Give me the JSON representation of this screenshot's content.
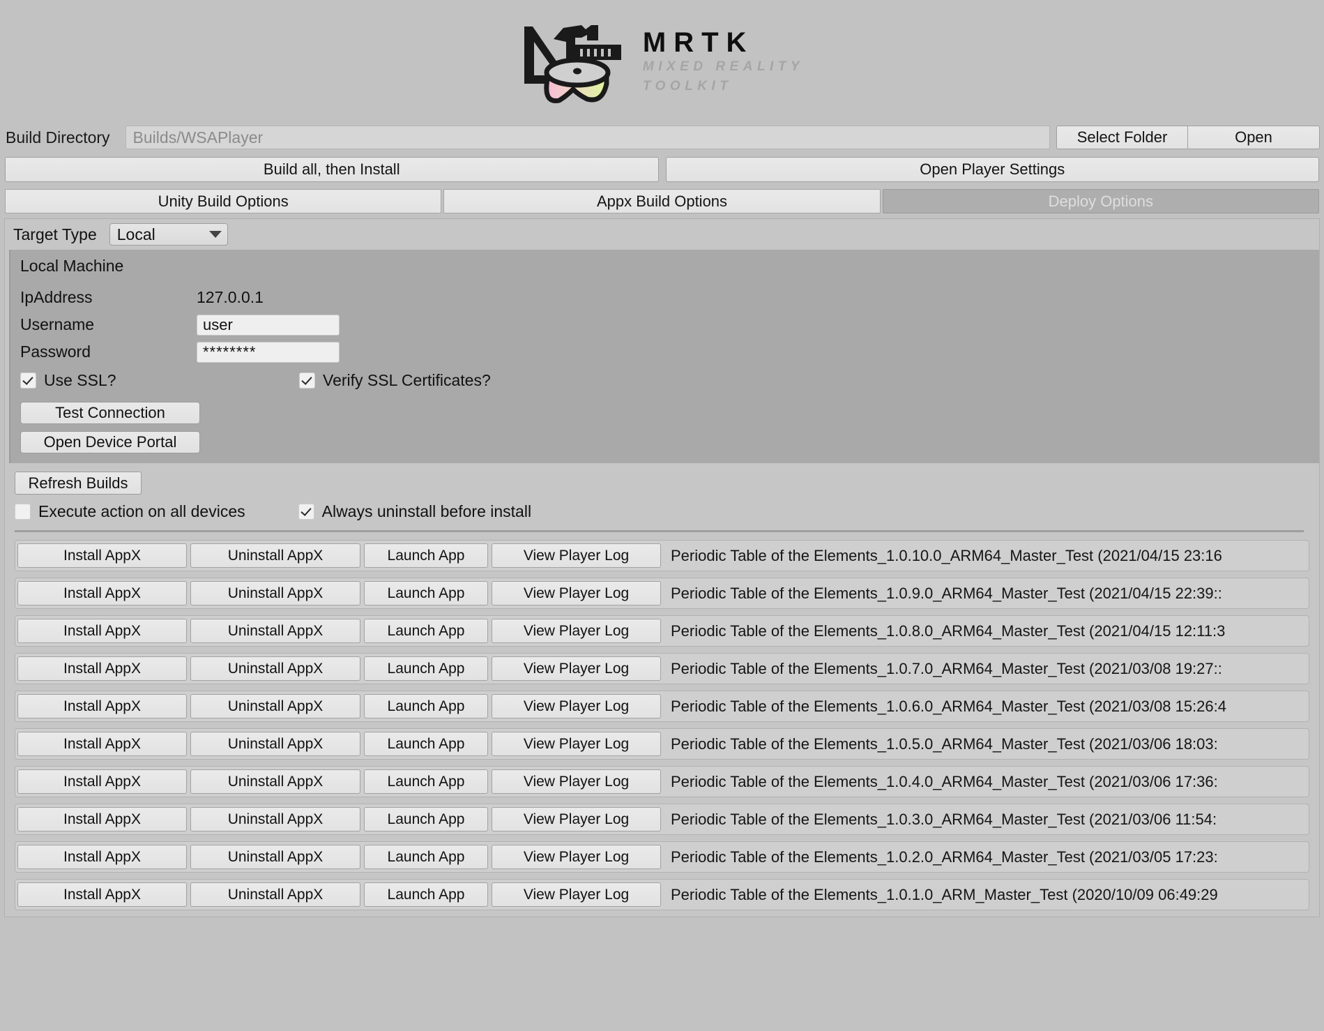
{
  "branding": {
    "title": "MRTK",
    "subtitle_line1": "MIXED REALITY",
    "subtitle_line2": "TOOLKIT",
    "logo_icon": "mrtk-hammer-ruler-visor-logo",
    "visor_gradient_start": "#f7c0d8",
    "visor_gradient_end": "#dff5a0"
  },
  "build_directory": {
    "label": "Build Directory",
    "value": "Builds/WSAPlayer",
    "select_folder_label": "Select Folder",
    "open_label": "Open"
  },
  "actions": {
    "build_all_label": "Build all, then Install",
    "player_settings_label": "Open Player Settings"
  },
  "tabs": [
    {
      "label": "Unity Build Options",
      "active": false
    },
    {
      "label": "Appx Build Options",
      "active": false
    },
    {
      "label": "Deploy Options",
      "active": true
    }
  ],
  "target": {
    "label": "Target Type",
    "selected": "Local",
    "caret_icon": "chevron-down-icon"
  },
  "device": {
    "title": "Local Machine",
    "ip_label": "IpAddress",
    "ip_value": "127.0.0.1",
    "username_label": "Username",
    "username_value": "user",
    "password_label": "Password",
    "password_value": "********",
    "use_ssl_label": "Use SSL?",
    "use_ssl_checked": true,
    "verify_ssl_label": "Verify SSL Certificates?",
    "verify_ssl_checked": true,
    "test_connection_label": "Test Connection",
    "open_device_portal_label": "Open Device Portal"
  },
  "deploy_options": {
    "refresh_label": "Refresh Builds",
    "execute_all_label": "Execute action on all devices",
    "execute_all_checked": false,
    "always_uninstall_label": "Always uninstall before install",
    "always_uninstall_checked": true
  },
  "row_buttons": {
    "install": "Install AppX",
    "uninstall": "Uninstall AppX",
    "launch": "Launch App",
    "view_log": "View Player Log"
  },
  "builds": [
    {
      "name": "Periodic Table of the Elements_1.0.10.0_ARM64_Master_Test (2021/04/15 23:16"
    },
    {
      "name": "Periodic Table of the Elements_1.0.9.0_ARM64_Master_Test (2021/04/15 22:39::"
    },
    {
      "name": "Periodic Table of the Elements_1.0.8.0_ARM64_Master_Test (2021/04/15 12:11:3"
    },
    {
      "name": "Periodic Table of the Elements_1.0.7.0_ARM64_Master_Test (2021/03/08 19:27::"
    },
    {
      "name": "Periodic Table of the Elements_1.0.6.0_ARM64_Master_Test (2021/03/08 15:26:4"
    },
    {
      "name": "Periodic Table of the Elements_1.0.5.0_ARM64_Master_Test (2021/03/06 18:03:"
    },
    {
      "name": "Periodic Table of the Elements_1.0.4.0_ARM64_Master_Test (2021/03/06 17:36:"
    },
    {
      "name": "Periodic Table of the Elements_1.0.3.0_ARM64_Master_Test (2021/03/06 11:54:"
    },
    {
      "name": "Periodic Table of the Elements_1.0.2.0_ARM64_Master_Test (2021/03/05 17:23:"
    },
    {
      "name": "Periodic Table of the Elements_1.0.1.0_ARM_Master_Test (2020/10/09 06:49:29"
    }
  ]
}
